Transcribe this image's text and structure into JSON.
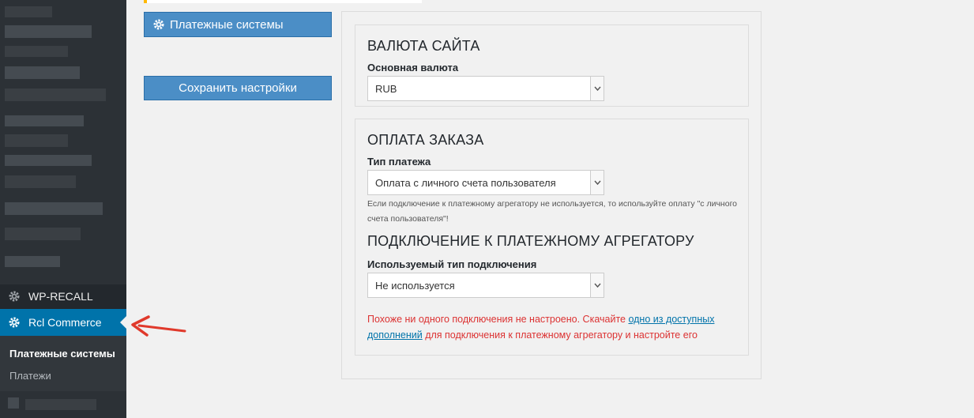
{
  "sidebar": {
    "menu": [
      {
        "label": "WP-RECALL",
        "icon": "gear-icon",
        "active": false
      },
      {
        "label": "Rcl Commerce",
        "icon": "gear-icon",
        "active": true
      }
    ],
    "submenu": [
      {
        "label": "Платежные системы",
        "current": true
      },
      {
        "label": "Платежи",
        "current": false
      }
    ]
  },
  "tabs": {
    "payment_systems": "Платежные системы",
    "save": "Сохранить настройки"
  },
  "currency_box": {
    "title": "ВАЛЮТА САЙТА",
    "label": "Основная валюта",
    "value": "RUB"
  },
  "payment_box": {
    "title": "ОПЛАТА ЗАКАЗА",
    "type_label": "Тип платежа",
    "type_value": "Оплата с личного счета пользователя",
    "note": "Если подключение к платежному агрегатору не используется, то используйте оплату \"с личного счета пользователя\"!",
    "aggregator_title": "ПОДКЛЮЧЕНИЕ К ПЛАТЕЖНОМУ АГРЕГАТОРУ",
    "connection_label": "Используемый тип подключения",
    "connection_value": "Не используется",
    "warning_before": "Похоже ни одного подключения не настроено. Скачайте ",
    "warning_link": "одно из доступных дополнений",
    "warning_after": " для подключения к платежному агрегатору и настройте его"
  },
  "colors": {
    "sidebar_bg": "#23282d",
    "accent": "#0073aa",
    "button_bg": "#4b8ec6",
    "warning": "#dc3232",
    "annotation_arrow": "#e0392b"
  }
}
